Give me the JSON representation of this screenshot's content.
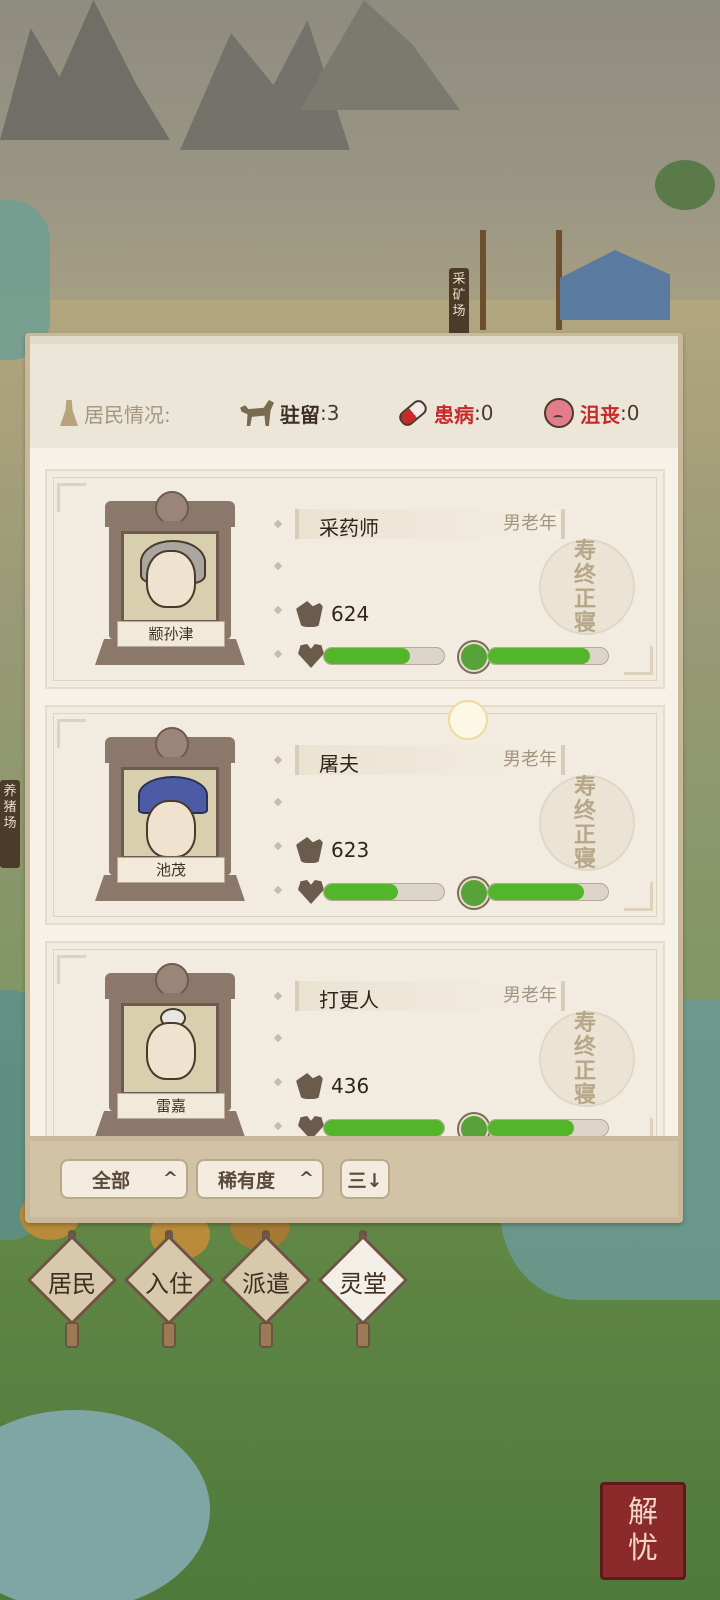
{
  "map": {
    "mine_sign": "采矿场",
    "pig_sign": "养猪场"
  },
  "header": {
    "label": "居民情况:",
    "station_label": "驻留",
    "station_value": ":3",
    "sick_label": "患病",
    "sick_value": ":0",
    "depress_label": "沮丧",
    "depress_value": ":0"
  },
  "residents": [
    {
      "name": "颛孙津",
      "job": "采药师",
      "tag": "男老年",
      "power": "624",
      "hp": 0.72,
      "mood": 0.85,
      "seal": [
        "寿",
        "终",
        "正",
        "寝"
      ]
    },
    {
      "name": "池茂",
      "job": "屠夫",
      "tag": "男老年",
      "power": "623",
      "hp": 0.62,
      "mood": 0.8,
      "seal": [
        "寿",
        "终",
        "正",
        "寝"
      ]
    },
    {
      "name": "雷嘉",
      "job": "打更人",
      "tag": "男老年",
      "power": "436",
      "hp": 1.0,
      "mood": 0.72,
      "seal": [
        "寿",
        "终",
        "正",
        "寝"
      ]
    }
  ],
  "filters": {
    "all_label": "全部",
    "rarity_label": "稀有度",
    "sort_icon": "sort-icon",
    "chevron": "^",
    "sort_glyph": "三↓"
  },
  "nav": {
    "residents": "居民",
    "move_in": "入住",
    "dispatch": "派遣",
    "spirit_hall": "灵堂"
  },
  "corner_stamp": {
    "line1": "解",
    "line2": "忧"
  },
  "colors": {
    "bar_fill": "#53b52a",
    "sick_red": "#c62a2a"
  }
}
